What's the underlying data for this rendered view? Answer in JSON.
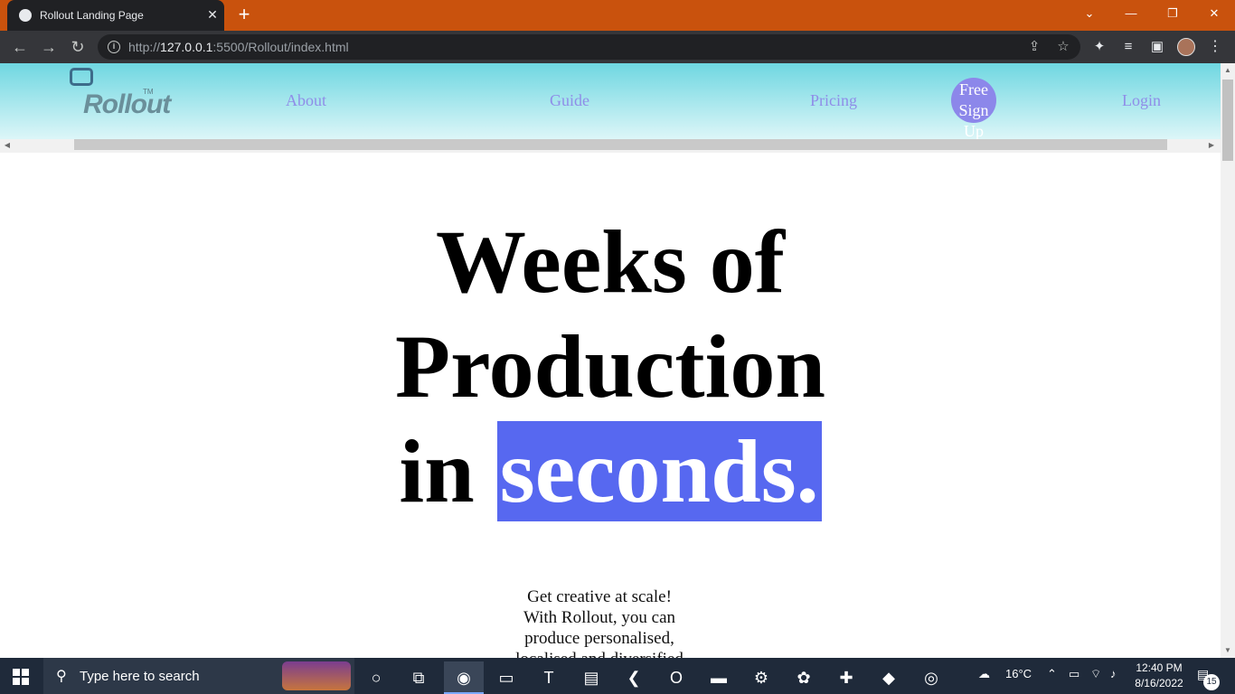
{
  "browser": {
    "tab_title": "Rollout Landing Page",
    "tab_close": "✕",
    "new_tab": "+",
    "url_host": "127.0.0.1",
    "url_scheme": "http://",
    "url_rest": ":5500/Rollout/index.html",
    "window_controls": {
      "dropdown": "⌄",
      "minimize": "—",
      "restore": "❐",
      "close": "✕"
    },
    "nav": {
      "back": "←",
      "forward": "→",
      "reload": "↻"
    },
    "toolbar_icons": {
      "share": "⇪",
      "bookmark": "☆",
      "extensions": "✦",
      "media": "≡",
      "side_panel": "▣",
      "menu": "⋮"
    }
  },
  "site": {
    "logo_text": "Rollout",
    "logo_tm": "TM",
    "nav": {
      "about": "About",
      "guide": "Guide",
      "pricing": "Pricing",
      "login": "Login"
    },
    "signup_lines": [
      "Free",
      "Sign",
      "Up"
    ]
  },
  "hero": {
    "line1": "Weeks of",
    "line2": "Production",
    "line3_prefix": "in",
    "line3_highlight": "seconds.",
    "highlight_color": "#5768f0"
  },
  "subtext": {
    "lines": [
      "Get creative at scale!",
      "With Rollout, you can",
      "produce personalised,",
      "localised and diversified"
    ]
  },
  "taskbar": {
    "search_placeholder": "Type here to search",
    "weather": "16°C",
    "time": "12:40 PM",
    "date": "8/16/2022",
    "notification_count": "15"
  }
}
